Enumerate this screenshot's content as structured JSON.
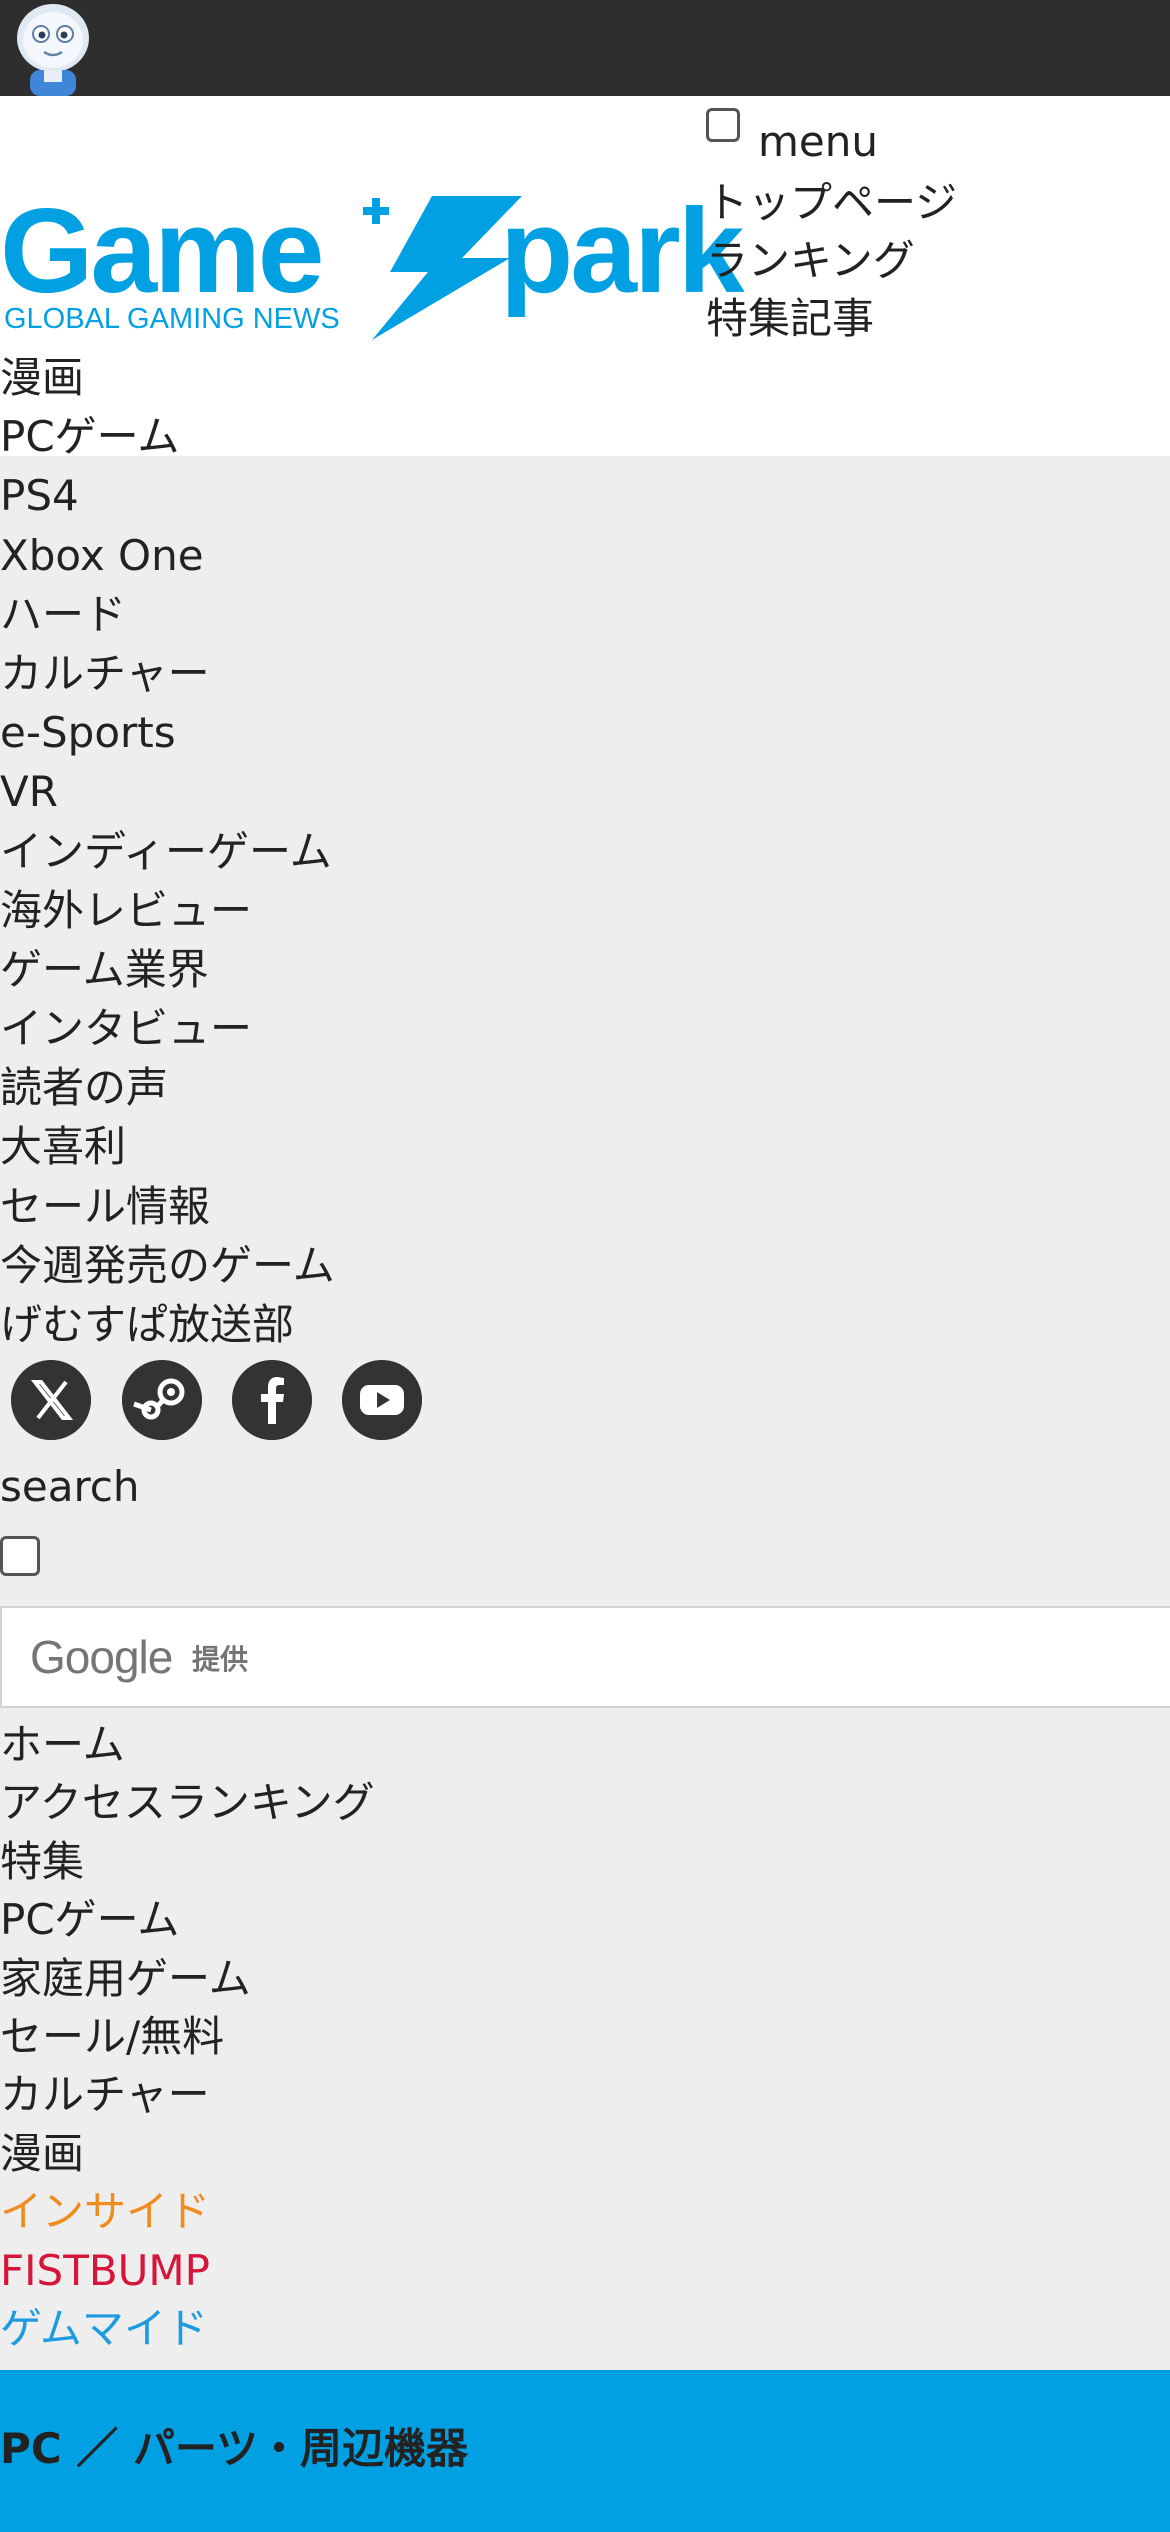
{
  "header": {
    "avatar_icon": "robot-mascot-icon",
    "logo": {
      "name": "GameSpark",
      "tagline": "GLOBAL GAMING NEWS"
    },
    "menu_label": "menu",
    "top_links": [
      "トップページ",
      "ランキング",
      "特集記事"
    ]
  },
  "nav": {
    "items": [
      "漫画",
      "PCゲーム",
      "PS4",
      "Xbox One",
      "ハード",
      "カルチャー",
      "e-Sports",
      "VR",
      "インディーゲーム",
      "海外レビュー",
      "ゲーム業界",
      "インタビュー",
      "読者の声",
      "大喜利",
      "セール情報",
      "今週発売のゲーム",
      "げむすぱ放送部"
    ]
  },
  "social": [
    "x-icon",
    "steam-icon",
    "facebook-icon",
    "youtube-icon"
  ],
  "search": {
    "label": "search",
    "provider_word": "Google",
    "provider_suffix": "提供"
  },
  "site_links": {
    "items": [
      "ホーム",
      "アクセスランキング",
      "特集",
      "PCゲーム",
      "家庭用ゲーム",
      "セール/無料",
      "カルチャー",
      "漫画"
    ],
    "partners": [
      {
        "label": "インサイド",
        "color": "#f08c1e"
      },
      {
        "label": "FISTBUMP",
        "color": "#d6153a"
      },
      {
        "label": "ゲムマイド",
        "color": "#1e9be0"
      }
    ]
  },
  "breadcrumb": "PC ／ パーツ・周辺機器",
  "colors": {
    "topbar": "#2e2e2e",
    "logo_blue": "#00a0e3",
    "gray_bg": "#eeeeee"
  }
}
